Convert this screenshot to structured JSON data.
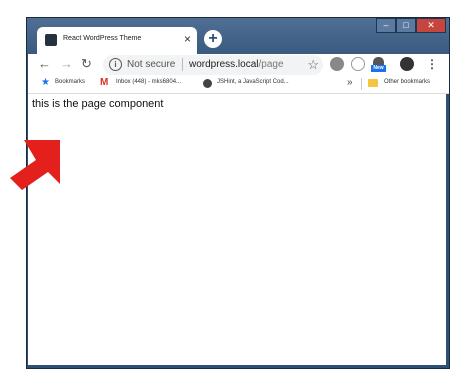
{
  "tab": {
    "title": "React WordPress Theme",
    "close_glyph": "×"
  },
  "new_tab_glyph": "+",
  "window_controls": {
    "min": "–",
    "max": "□",
    "close": "✕"
  },
  "nav": {
    "back": "←",
    "forward": "→",
    "reload": "↻"
  },
  "omnibox": {
    "info": "i",
    "security_label": "Not secure",
    "host": "wordpress.local",
    "path": "/page"
  },
  "extensions": {
    "badge": "New"
  },
  "bookmarks": {
    "items": [
      {
        "label": "Bookmarks"
      },
      {
        "label": "Inbox (448) - mks6804..."
      },
      {
        "label": "JSHint, a JavaScript Cod..."
      }
    ],
    "overflow": "»",
    "other": "Other bookmarks"
  },
  "page": {
    "text": "this is the page component"
  },
  "colors": {
    "frame": "#2f4f73",
    "arrow": "#e3201b",
    "bookmark_star": "#1a73e8"
  }
}
